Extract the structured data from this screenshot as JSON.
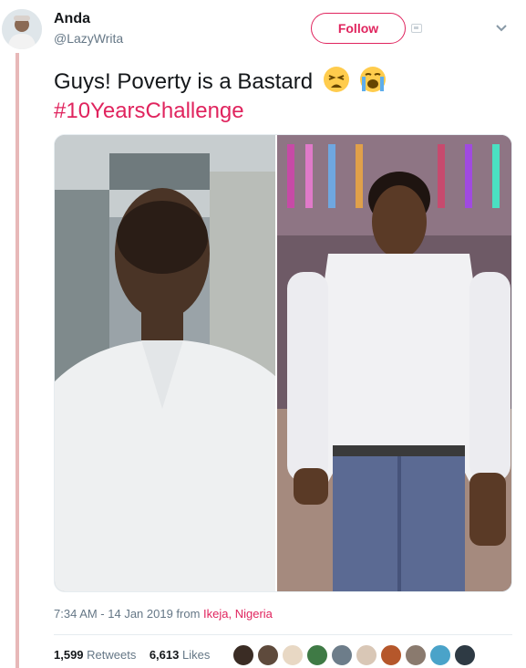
{
  "tweet": {
    "display_name": "Anda",
    "handle": "@LazyWrita",
    "follow_label": "Follow",
    "text": "Guys! Poverty is a Bastard",
    "emojis": [
      "weary-face",
      "loudly-crying-face"
    ],
    "hashtag": "#10YearsChallenge",
    "time": "7:34 AM - 14 Jan 2019 from ",
    "location": "Ikeja, Nigeria",
    "retweets_count": "1,599",
    "retweets_label": "Retweets",
    "likes_count": "6,613",
    "likes_label": "Likes",
    "liker_avatar_count": 10
  },
  "colors": {
    "accent": "#e0245e",
    "text": "#14171a",
    "muted": "#657786",
    "thread_line": "#e7b8b8"
  },
  "icons": [
    "avatar",
    "block-icon",
    "chevron-down-icon",
    "weary-face-emoji",
    "crying-face-emoji"
  ]
}
